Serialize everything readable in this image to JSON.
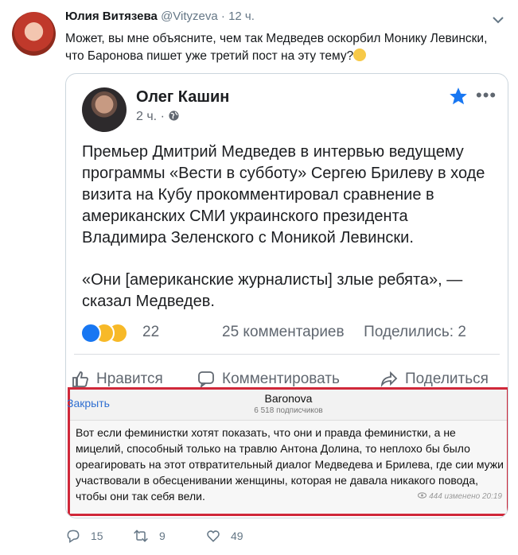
{
  "tweet": {
    "author_name": "Юлия Витязева",
    "author_handle": "@Vityzeva",
    "separator": "·",
    "time": "12 ч.",
    "text": "Может, вы мне объясните, чем так Медведев оскорбил Монику Левински, что Баронова пишет уже третий пост на эту тему?",
    "icons": {
      "avatar": "user-photo",
      "menu": "chevron-down-icon",
      "emoji": "thinking-face-emoji"
    }
  },
  "fb_post": {
    "author": "Олег Кашин",
    "time": "2 ч.",
    "dot": "·",
    "paragraphs": [
      "Премьер Дмитрий Медведев в интервью ведущему программы «Вести в субботу» Сергею Брилеву в ходе визита на Кубу прокомментировал сравнение в американских СМИ украинского президента Владимира Зеленского с Моникой Левински.",
      "«Они [американские журналисты] злые ребята», — сказал Медведев."
    ],
    "reactions_count": "22",
    "comments": "25 комментариев",
    "shares": "Поделились: 2",
    "actions": {
      "like": "Нравится",
      "comment": "Комментировать",
      "share": "Поделиться"
    },
    "colors": {
      "like": "#1877f2",
      "haha": "#f7b928",
      "sad": "#f7b928",
      "star": "#1877f2"
    }
  },
  "overlay": {
    "close": "Закрыть",
    "title": "Baronova",
    "subscribers": "6 518 подписчиков",
    "text": "Вот если феминистки хотят показать, что они и правда феминистки, а не мицелий, способный только на травлю Антона Долина, то неплохо бы было ореагировать на этот отвратительный диалог Медведева и Брилева, где сии мужи участвовали в обесценивании женщины, которая не давала никакого повода, чтобы они так себя вели.",
    "views": "444",
    "edited": "изменено 20:19",
    "border_color": "#d0283a"
  },
  "tweet_actions": {
    "replies": "15",
    "retweets": "9",
    "likes": "49"
  }
}
